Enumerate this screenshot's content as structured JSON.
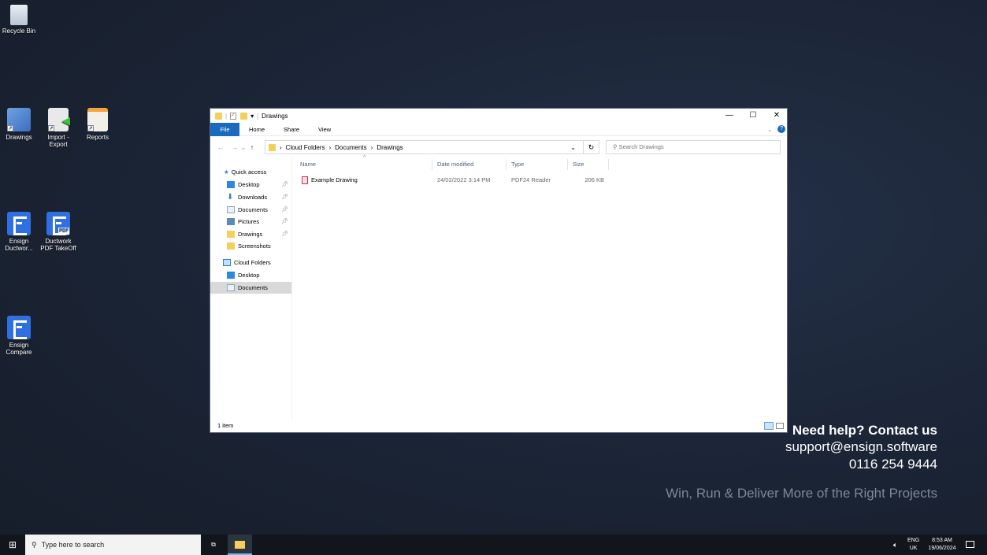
{
  "desktop": {
    "icons": [
      {
        "label": "Recycle Bin"
      },
      {
        "label": "Drawings"
      },
      {
        "label": "Import - Export"
      },
      {
        "label": "Reports"
      },
      {
        "label": "Ensign Ductwor..."
      },
      {
        "label": "Ductwork PDF TakeOff"
      },
      {
        "label": "Ensign Compare"
      }
    ],
    "pdf_badge": "PDF",
    "help": {
      "title": "Need help? Contact us",
      "email": "support@ensign.software",
      "phone": "0116 254 9444",
      "tagline": "Win, Run & Deliver More of the Right Projects"
    }
  },
  "explorer": {
    "title": "Drawings",
    "ribbon_tabs": [
      "File",
      "Home",
      "Share",
      "View"
    ],
    "path": [
      "Cloud Folders",
      "Documents",
      "Drawings"
    ],
    "search_placeholder": "Search Drawings",
    "nav": {
      "quick_access": "Quick access",
      "quick_items": [
        "Desktop",
        "Downloads",
        "Documents",
        "Pictures",
        "Drawings",
        "Screenshots"
      ],
      "cloud": "Cloud Folders",
      "cloud_items": [
        "Desktop",
        "Documents"
      ]
    },
    "columns": [
      "Name",
      "Date modified",
      "Type",
      "Size"
    ],
    "files": [
      {
        "name": "Example Drawing",
        "date": "24/02/2022 3:14 PM",
        "type": "PDF24 Reader",
        "size": "206 KB"
      }
    ],
    "status": "1 item"
  },
  "taskbar": {
    "search_placeholder": "Type here to search",
    "lang1": "ENG",
    "lang2": "UK",
    "time": "8:53 AM",
    "date": "19/06/2024"
  }
}
